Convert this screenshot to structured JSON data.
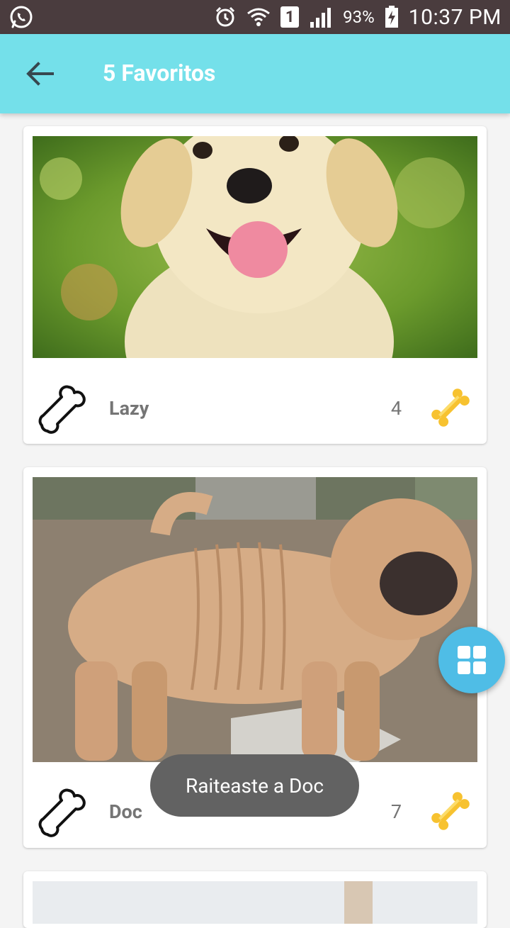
{
  "status_bar": {
    "battery_percent": "93%",
    "sim_slot": "1",
    "time": "10:37 PM",
    "icons": [
      "whatsapp-icon",
      "alarm-icon",
      "wifi-icon",
      "sim-1-icon",
      "signal-icon",
      "battery-charging-icon"
    ]
  },
  "appbar": {
    "title": "5 Favoritos",
    "back_icon": "arrow-left-icon",
    "color": "#74e0ea"
  },
  "cards": [
    {
      "name": "Lazy",
      "rating": "4",
      "photo": "yellow labrador puppy"
    },
    {
      "name": "Doc",
      "rating": "7",
      "photo": "shar pei puppy"
    }
  ],
  "fab": {
    "icon": "grid-icon",
    "color": "#4fbde6"
  },
  "toast": {
    "text": "Raiteaste a Doc"
  },
  "colors": {
    "bone_gold": "#f7c230",
    "text_gray": "#757575"
  }
}
